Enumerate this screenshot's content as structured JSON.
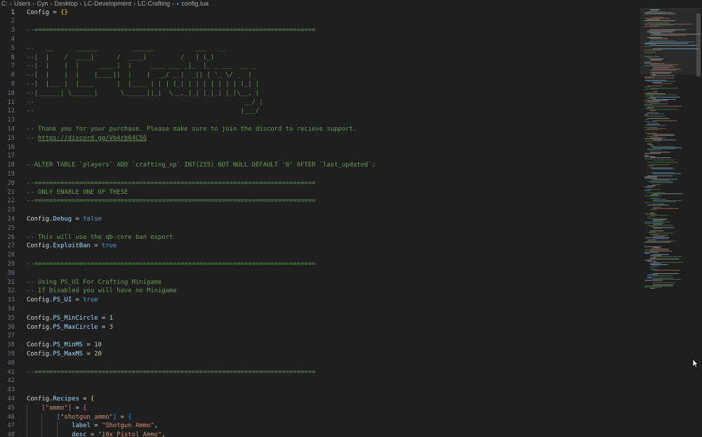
{
  "breadcrumb": {
    "segments": [
      "C:",
      "Users",
      "Cyn",
      "Desktop",
      "LC-Development",
      "LC-Crafting"
    ],
    "file": "config.lua"
  },
  "colors": {
    "background": "#1f1f1f",
    "comment": "#6a9955",
    "keyword": "#569cd6",
    "variable": "#9cdcfe",
    "number": "#b5cea8",
    "string": "#ce9178",
    "bracket_gold": "#ffd700",
    "bracket_purple": "#da70d6",
    "bracket_blue": "#179fff"
  },
  "editor": {
    "active_line": 1,
    "lines": [
      {
        "n": 1,
        "tokens": [
          [
            "tx",
            "Config = "
          ],
          [
            "br",
            "{}"
          ]
        ]
      },
      {
        "n": 2,
        "tokens": []
      },
      {
        "n": 3,
        "tokens": [
          [
            "cm",
            "--==========================================================================="
          ]
        ]
      },
      {
        "n": 4,
        "tokens": []
      },
      {
        "n": 5,
        "tokens": [
          [
            "cm",
            "--   __      ______         ______           ___   __"
          ]
        ]
      },
      {
        "n": 6,
        "tokens": [
          [
            "cm",
            "--|  |    /  ____|      /  ____|         /   | (_)"
          ]
        ]
      },
      {
        "n": 7,
        "tokens": [
          [
            "cm",
            "--|  |    |  |     ____ |  |     ____ ___ _|_  |_ _ ___  __ _"
          ]
        ]
      },
      {
        "n": 8,
        "tokens": [
          [
            "cm",
            "--|  |    |  |    |____||  |    |  __/ _ |  _|| | '_ \\/ _` |"
          ]
        ]
      },
      {
        "n": 9,
        "tokens": [
          [
            "cm",
            "--|  |___ |  |____      |  |____ | | | (_| | | | | | | | (_| |"
          ]
        ]
      },
      {
        "n": 10,
        "tokens": [
          [
            "cm",
            "--|______| \\______|      \\______||_|  \\__,_|_| |_|_| |_|\\__, |"
          ]
        ]
      },
      {
        "n": 11,
        "tokens": [
          [
            "cm",
            "--                                                        __/ |"
          ]
        ]
      },
      {
        "n": 12,
        "tokens": [
          [
            "cm",
            "--                                                       |___/"
          ]
        ]
      },
      {
        "n": 13,
        "tokens": []
      },
      {
        "n": 14,
        "tokens": [
          [
            "cm",
            "-- Thank you for your purchase. Please make sure to join the discord to recieve support."
          ]
        ]
      },
      {
        "n": 15,
        "tokens": [
          [
            "cm",
            "-- "
          ],
          [
            "lk",
            "https://discord.gg/VbArb64C56"
          ]
        ]
      },
      {
        "n": 16,
        "tokens": []
      },
      {
        "n": 17,
        "tokens": []
      },
      {
        "n": 18,
        "tokens": [
          [
            "cm",
            "--ALTER TABLE `players` ADD `crafting_xp` INT(255) NOT NULL DEFAULT '0' AFTER `last_updated`;"
          ]
        ]
      },
      {
        "n": 19,
        "tokens": []
      },
      {
        "n": 20,
        "tokens": [
          [
            "cm",
            "--==========================================================================="
          ]
        ]
      },
      {
        "n": 21,
        "tokens": [
          [
            "cm",
            "-- ONLY ENABLE ONE OF THESE"
          ]
        ]
      },
      {
        "n": 22,
        "tokens": [
          [
            "cm",
            "--==========================================================================="
          ]
        ]
      },
      {
        "n": 23,
        "tokens": []
      },
      {
        "n": 24,
        "tokens": [
          [
            "tx",
            "Config."
          ],
          [
            "vr",
            "Debug"
          ],
          [
            "tx",
            " = "
          ],
          [
            "kw",
            "false"
          ]
        ]
      },
      {
        "n": 25,
        "tokens": []
      },
      {
        "n": 26,
        "tokens": [
          [
            "cm",
            "-- This will use the qb-core ban export"
          ]
        ]
      },
      {
        "n": 27,
        "tokens": [
          [
            "tx",
            "Config."
          ],
          [
            "vr",
            "ExploitBan"
          ],
          [
            "tx",
            " = "
          ],
          [
            "kw",
            "true"
          ]
        ]
      },
      {
        "n": 28,
        "tokens": []
      },
      {
        "n": 29,
        "tokens": [
          [
            "cm",
            "--==========================================================================="
          ]
        ]
      },
      {
        "n": 30,
        "tokens": []
      },
      {
        "n": 31,
        "tokens": [
          [
            "cm",
            "-- Using PS_UI For Crafting Minigame"
          ]
        ]
      },
      {
        "n": 32,
        "tokens": [
          [
            "cm",
            "-- If Disabled you will have no Minigame"
          ]
        ]
      },
      {
        "n": 33,
        "tokens": [
          [
            "tx",
            "Config."
          ],
          [
            "vr",
            "PS_UI"
          ],
          [
            "tx",
            " = "
          ],
          [
            "kw",
            "true"
          ]
        ]
      },
      {
        "n": 34,
        "tokens": []
      },
      {
        "n": 35,
        "tokens": [
          [
            "tx",
            "Config."
          ],
          [
            "vr",
            "PS_MinCircle"
          ],
          [
            "tx",
            " = "
          ],
          [
            "nm",
            "1"
          ]
        ]
      },
      {
        "n": 36,
        "tokens": [
          [
            "tx",
            "Config."
          ],
          [
            "vr",
            "PS_MaxCircle"
          ],
          [
            "tx",
            " = "
          ],
          [
            "nm",
            "3"
          ]
        ]
      },
      {
        "n": 37,
        "tokens": []
      },
      {
        "n": 38,
        "tokens": [
          [
            "tx",
            "Config."
          ],
          [
            "vr",
            "PS_MinMS"
          ],
          [
            "tx",
            " = "
          ],
          [
            "nm",
            "10"
          ]
        ]
      },
      {
        "n": 39,
        "tokens": [
          [
            "tx",
            "Config."
          ],
          [
            "vr",
            "PS_MaxMS"
          ],
          [
            "tx",
            " = "
          ],
          [
            "nm",
            "20"
          ]
        ]
      },
      {
        "n": 40,
        "tokens": []
      },
      {
        "n": 41,
        "tokens": [
          [
            "cm",
            "--==========================================================================="
          ]
        ]
      },
      {
        "n": 42,
        "tokens": []
      },
      {
        "n": 43,
        "tokens": []
      },
      {
        "n": 44,
        "tokens": [
          [
            "tx",
            "Config."
          ],
          [
            "vr",
            "Recipes"
          ],
          [
            "tx",
            " = "
          ],
          [
            "br",
            "{"
          ]
        ]
      },
      {
        "n": 45,
        "guides": 1,
        "tokens": [
          [
            "tx",
            "    "
          ],
          [
            "pk",
            "["
          ],
          [
            "st",
            "\"ammo\""
          ],
          [
            "pk",
            "]"
          ],
          [
            "tx",
            " = "
          ],
          [
            "pk",
            "{"
          ]
        ]
      },
      {
        "n": 46,
        "guides": 2,
        "tokens": [
          [
            "tx",
            "        "
          ],
          [
            "sk",
            "["
          ],
          [
            "st",
            "\"shotgun_ammo\""
          ],
          [
            "sk",
            "]"
          ],
          [
            "tx",
            " = "
          ],
          [
            "sk",
            "{"
          ]
        ]
      },
      {
        "n": 47,
        "guides": 3,
        "tokens": [
          [
            "tx",
            "            "
          ],
          [
            "vr",
            "label"
          ],
          [
            "tx",
            " = "
          ],
          [
            "st",
            "\"Shotgun Ammo\""
          ],
          [
            "tx",
            ","
          ]
        ]
      },
      {
        "n": 48,
        "guides": 3,
        "tokens": [
          [
            "tx",
            "            "
          ],
          [
            "vr",
            "desc"
          ],
          [
            "tx",
            " = "
          ],
          [
            "st",
            "\"10x Pistol Ammo\""
          ],
          [
            "tx",
            ","
          ]
        ]
      }
    ]
  }
}
